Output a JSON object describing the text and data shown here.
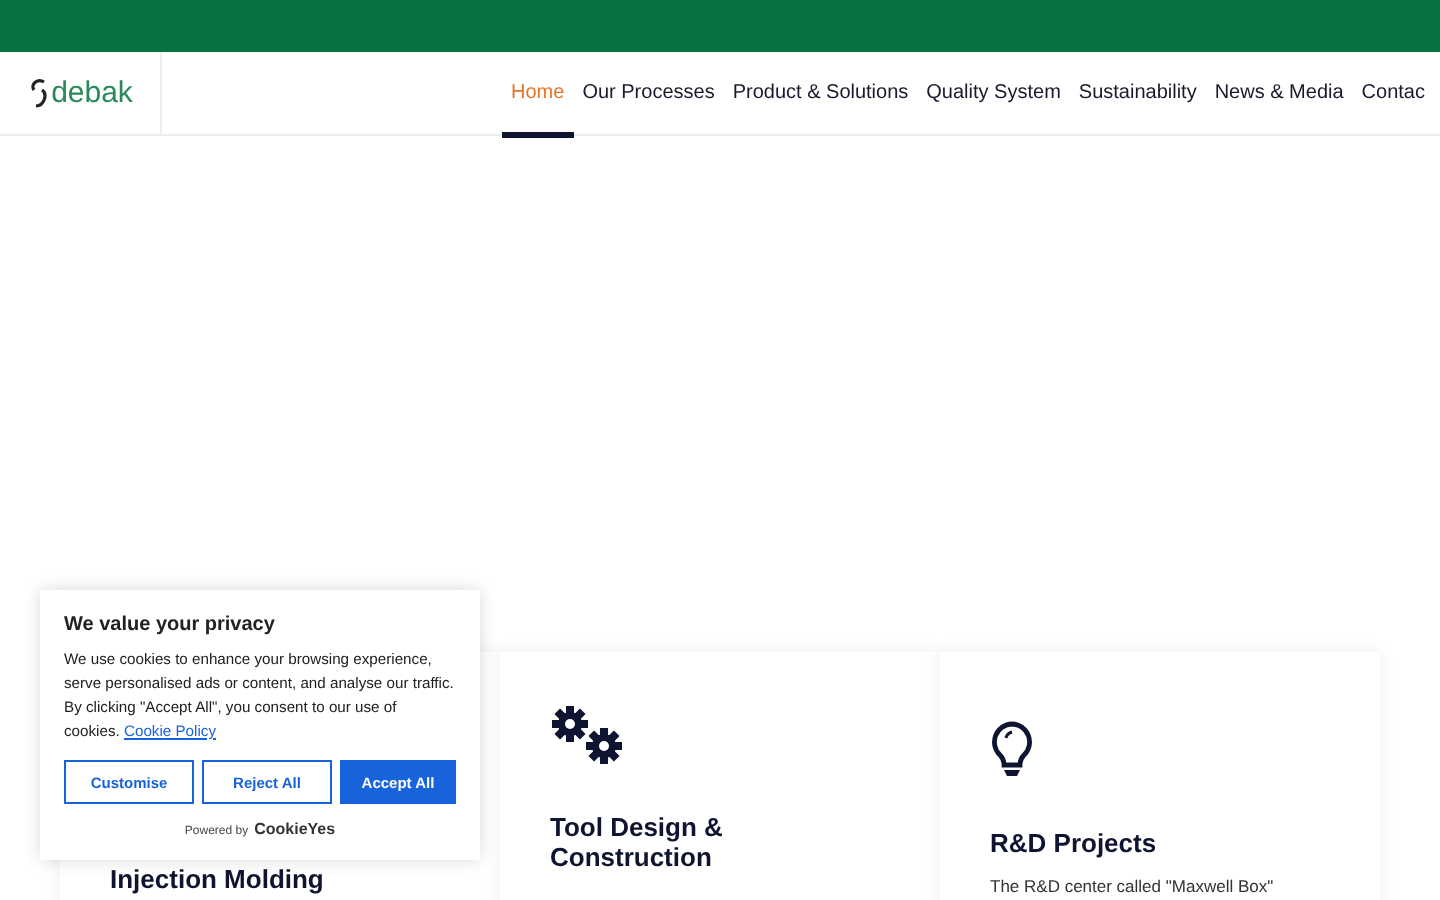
{
  "logo": {
    "text": "debak"
  },
  "nav": [
    {
      "label": "Home",
      "selected": true
    },
    {
      "label": "Our Processes",
      "selected": false
    },
    {
      "label": "Product & Solutions",
      "selected": false
    },
    {
      "label": "Quality System",
      "selected": false
    },
    {
      "label": "Sustainability",
      "selected": false
    },
    {
      "label": "News & Media",
      "selected": false
    },
    {
      "label": "Contac",
      "selected": false
    }
  ],
  "cards": [
    {
      "kind": "none",
      "title": "Injection Molding"
    },
    {
      "kind": "gears",
      "title": "Tool Design & Construction"
    },
    {
      "kind": "bulb",
      "title": "R&D Projects",
      "text": "The R&D center called \"Maxwell Box\""
    }
  ],
  "cookie_banner": {
    "title": "We value your privacy",
    "text": "We use cookies to enhance your browsing experience, serve personalised ads or content, and analyse our traffic. By clicking \"Accept All\", you consent to our use of cookies.",
    "link": "Cookie Policy",
    "buttons": [
      {
        "label": "Customise",
        "kind": "outline"
      },
      {
        "label": "Reject All",
        "kind": "outline"
      },
      {
        "label": "Accept All",
        "kind": "primary"
      }
    ],
    "powered_by": "Powered by",
    "brand": "CookieYes"
  }
}
